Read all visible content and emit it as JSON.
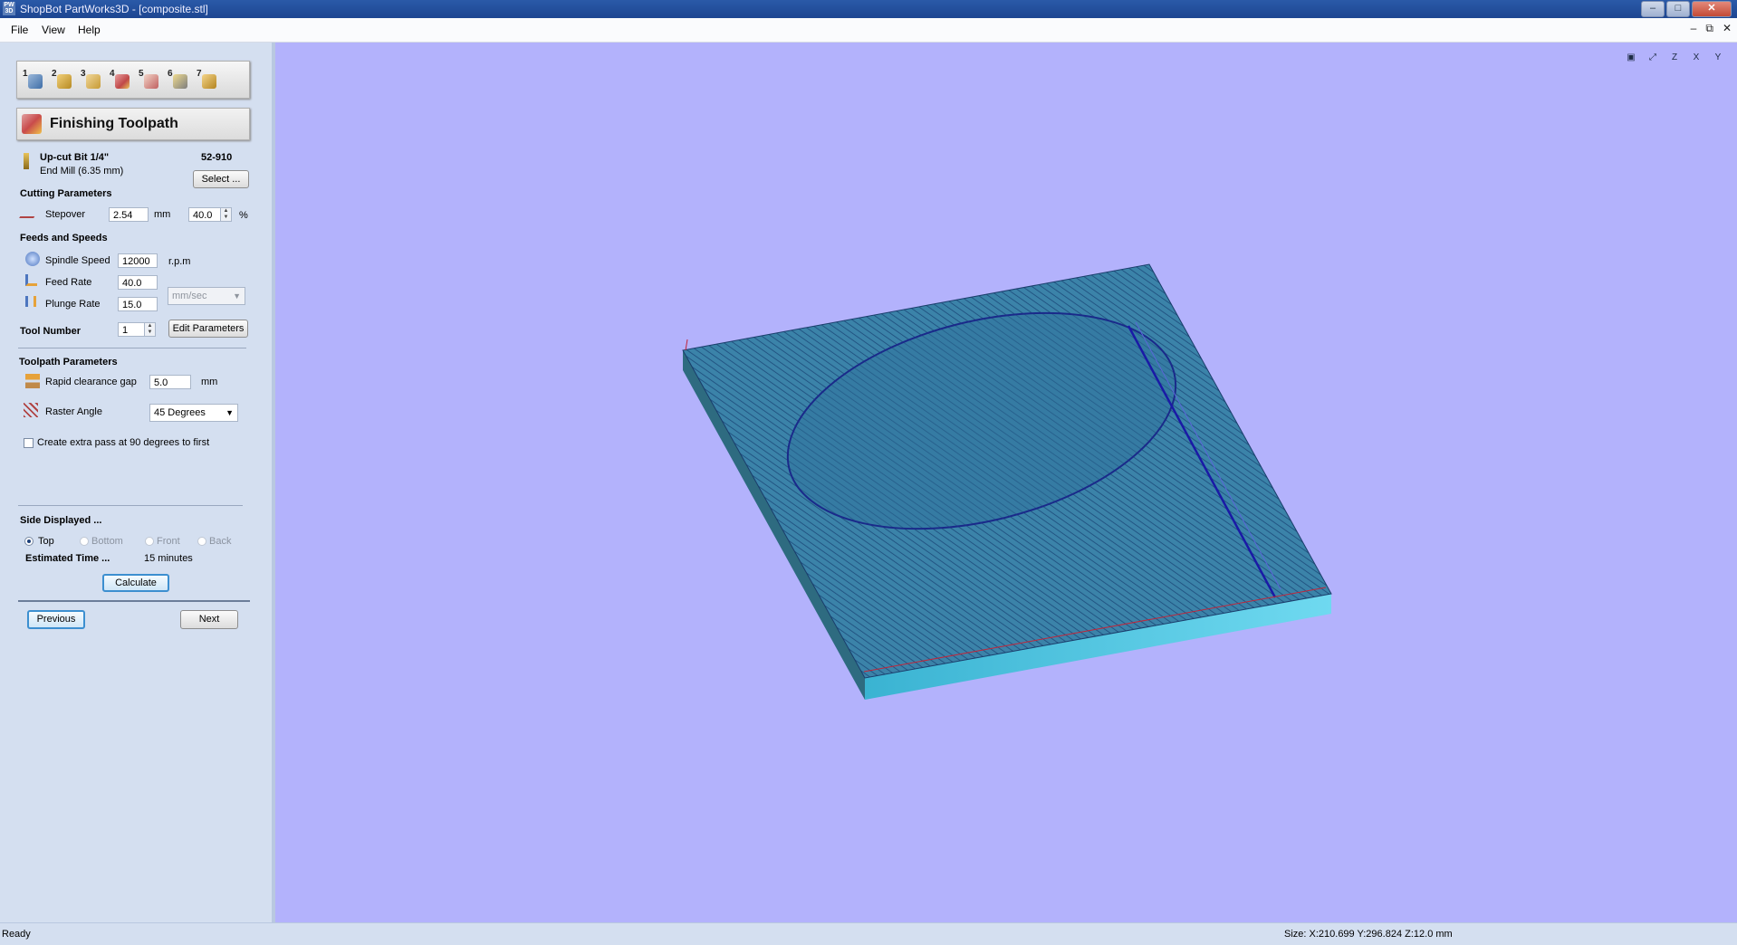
{
  "window": {
    "title": "ShopBot PartWorks3D - [composite.stl]",
    "app_icon": "PW 3D"
  },
  "menu": [
    "File",
    "View",
    "Help"
  ],
  "toolbar": {
    "steps": [
      "1",
      "2",
      "3",
      "4",
      "5",
      "6",
      "7"
    ]
  },
  "panel": {
    "title": "Finishing Toolpath",
    "tool": {
      "name": "Up-cut Bit 1/4\"",
      "desc": "End Mill (6.35 mm)",
      "code": "52-910",
      "select_label": "Select ..."
    },
    "cutting": {
      "heading": "Cutting Parameters",
      "stepover_label": "Stepover",
      "stepover_mm": "2.54",
      "mm_unit": "mm",
      "stepover_pct": "40.0",
      "pct_unit": "%"
    },
    "feeds": {
      "heading": "Feeds and Speeds",
      "spindle_label": "Spindle Speed",
      "spindle_value": "12000",
      "spindle_unit": "r.p.m",
      "feed_label": "Feed Rate",
      "feed_value": "40.0",
      "plunge_label": "Plunge Rate",
      "plunge_value": "15.0",
      "rate_unit": "mm/sec"
    },
    "tool_number": {
      "label": "Tool Number",
      "value": "1",
      "edit_label": "Edit Parameters"
    },
    "toolpath": {
      "heading": "Toolpath Parameters",
      "clearance_label": "Rapid clearance gap",
      "clearance_value": "5.0",
      "clearance_unit": "mm",
      "raster_label": "Raster Angle",
      "raster_value": "45 Degrees",
      "extra_pass_label": "Create extra pass at 90 degrees to first"
    },
    "side": {
      "heading": "Side Displayed ...",
      "options": [
        "Top",
        "Bottom",
        "Front",
        "Back"
      ],
      "selected": "Top",
      "estimated_label": "Estimated Time ...",
      "estimated_value": "15 minutes",
      "calculate_label": "Calculate"
    },
    "nav": {
      "previous_label": "Previous",
      "next_label": "Next"
    }
  },
  "viewport": {
    "background": "#b3b2fc",
    "view_icons": [
      "fit-view-icon",
      "iso-view-icon",
      "z-view-icon",
      "x-view-icon",
      "y-view-icon"
    ],
    "view_icon_labels": [
      "▣",
      "⤢",
      "Z",
      "X",
      "Y"
    ]
  },
  "status": {
    "left": "Ready",
    "right": "Size: X:210.699 Y:296.824 Z:12.0 mm"
  }
}
